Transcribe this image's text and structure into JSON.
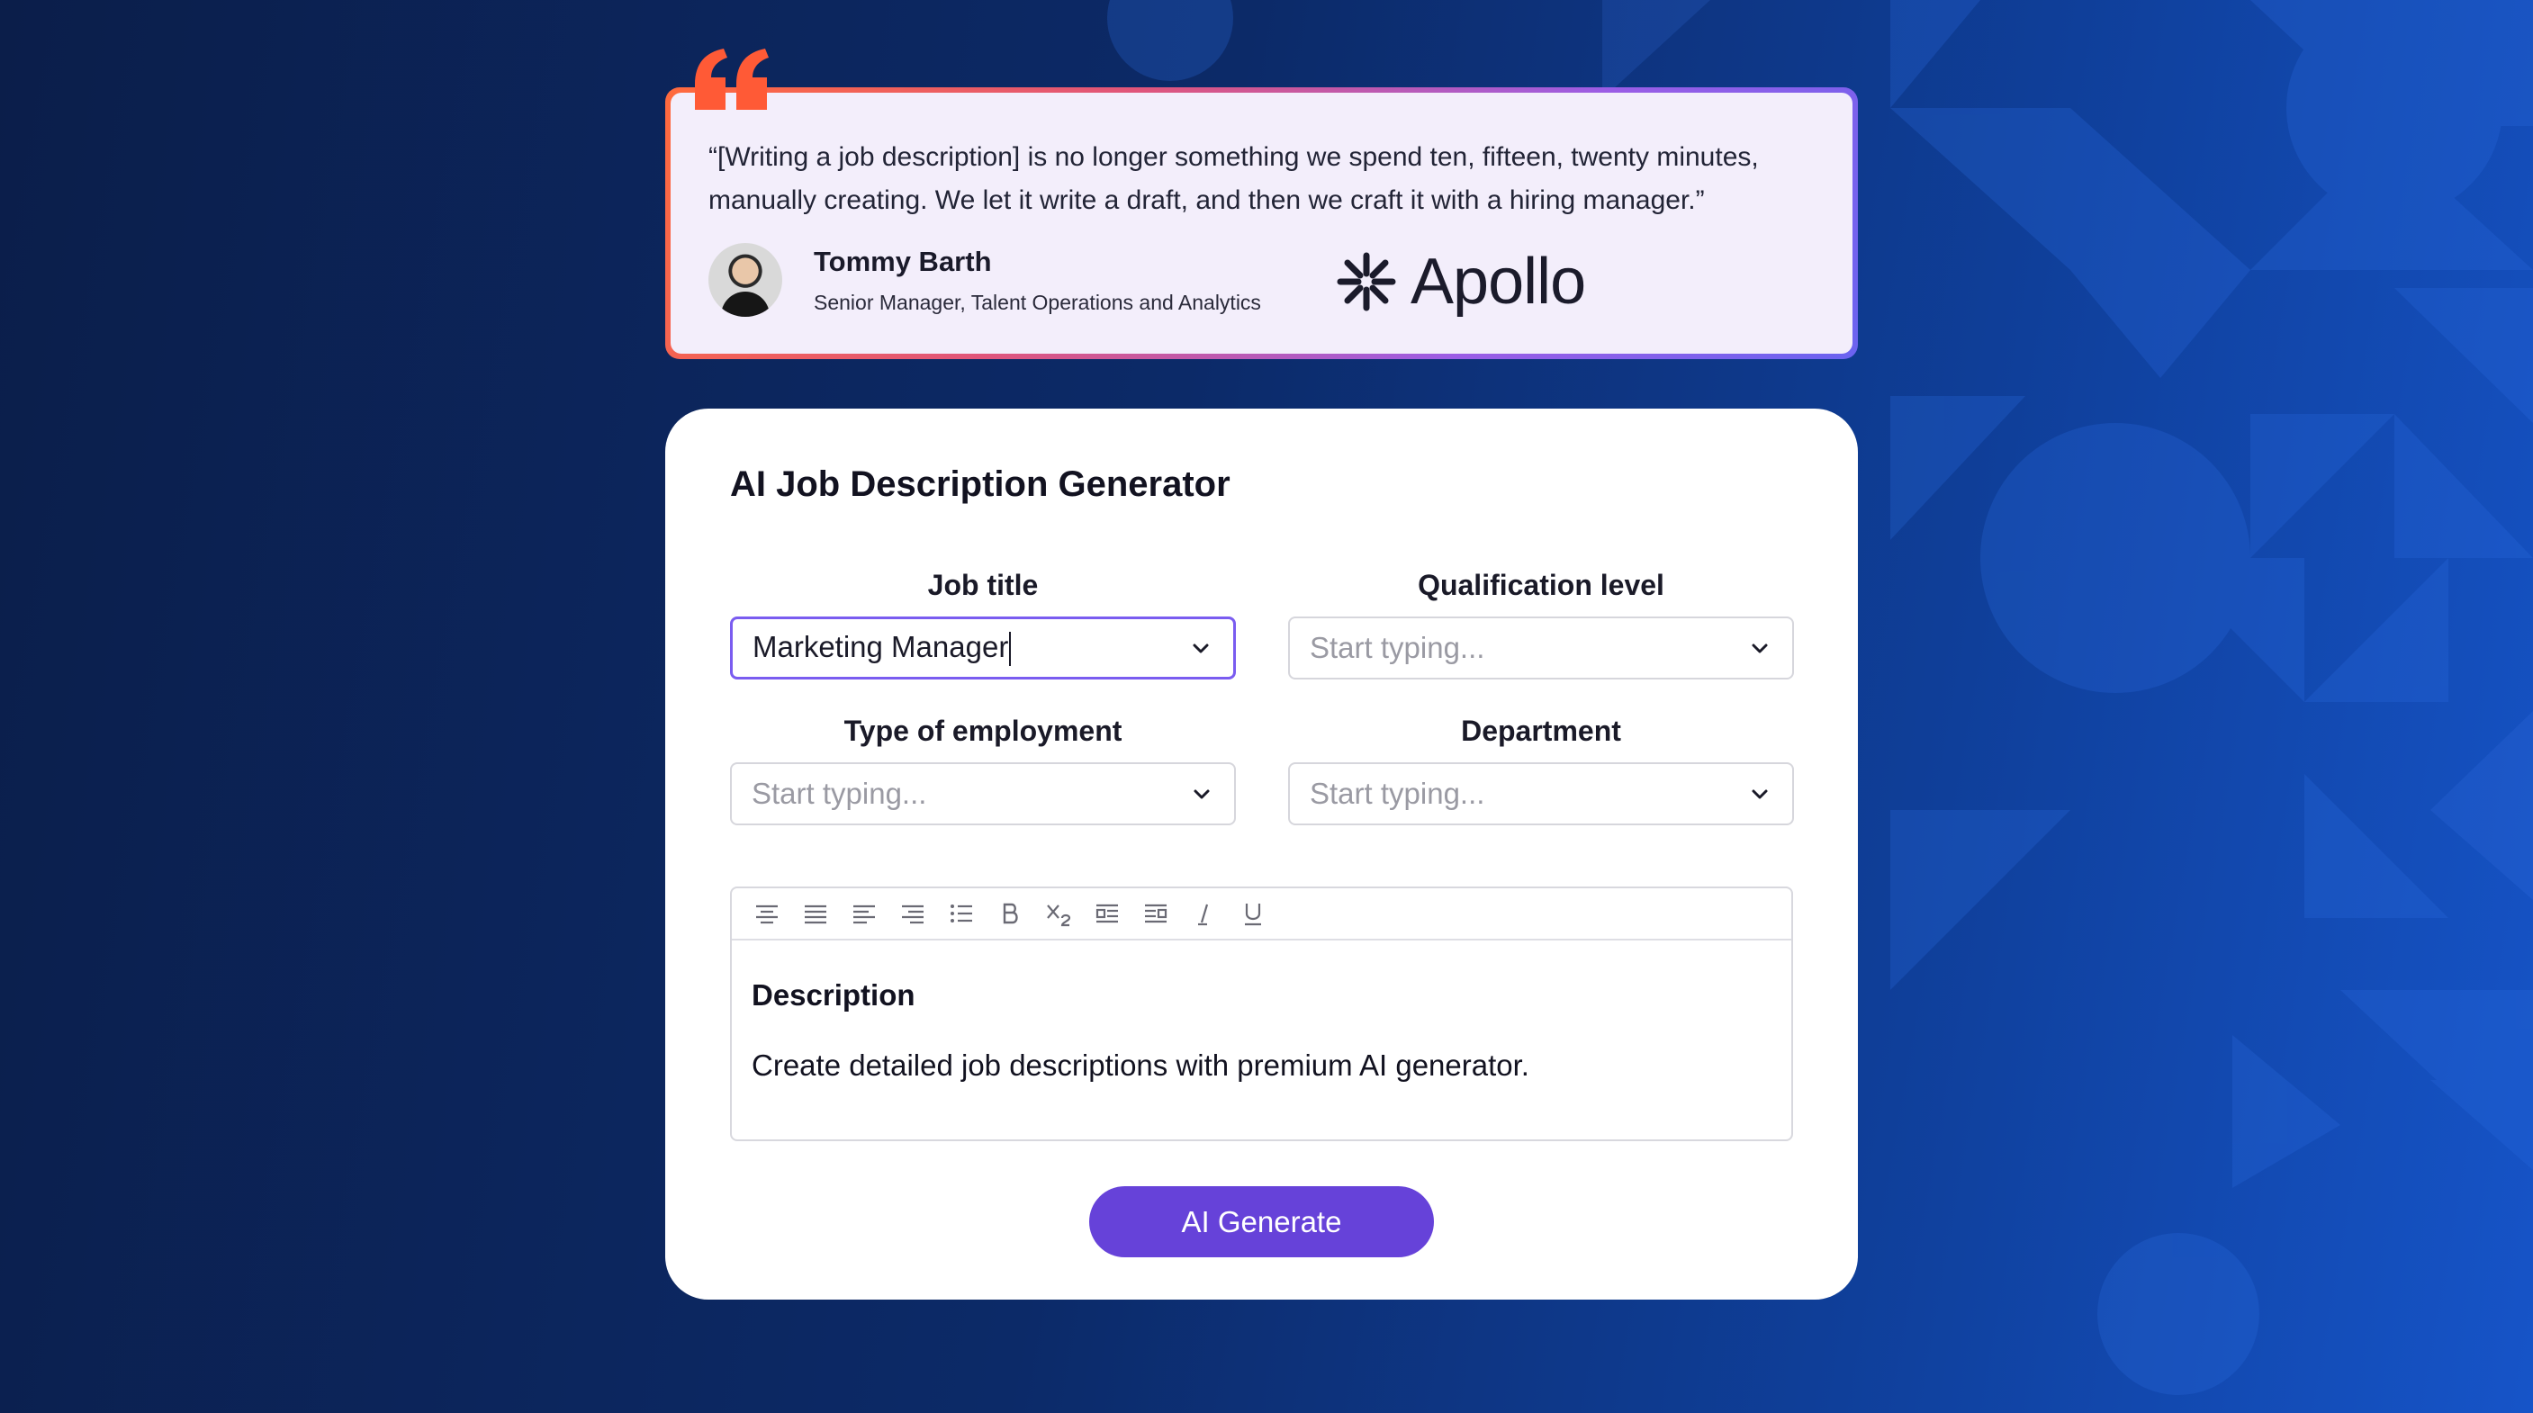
{
  "colors": {
    "background": "#0c2a68",
    "quote_mark": "#ff5a36",
    "primary": "#6642d9",
    "active_border": "#7a5cf0"
  },
  "testimonial": {
    "quote": "“[Writing a job description] is no longer something we spend ten, fifteen, twenty minutes, manually creating. We let it write a draft, and then we craft it with a hiring manager.”",
    "author_name": "Tommy Barth",
    "author_role": "Senior Manager, Talent Operations and Analytics",
    "company": "Apollo",
    "quote_icon": "quote-mark-icon",
    "logo_icon": "apollo-asterisk-logo"
  },
  "generator": {
    "title": "AI Job Description Generator",
    "fields": {
      "job_title": {
        "label": "Job title",
        "value": "Marketing Manager"
      },
      "qualification": {
        "label": "Qualification level",
        "placeholder": "Start typing..."
      },
      "employment": {
        "label": "Type of employment",
        "placeholder": "Start typing..."
      },
      "department": {
        "label": "Department",
        "placeholder": "Start typing..."
      }
    },
    "toolbar": [
      "align-center-icon",
      "align-justify-icon",
      "align-left-icon",
      "align-right-icon",
      "bullet-list-icon",
      "bold-icon",
      "subscript-icon",
      "indent-icon",
      "outdent-icon",
      "italic-icon",
      "underline-icon"
    ],
    "editor": {
      "heading": "Description",
      "body": "Create detailed job descriptions with premium AI generator."
    },
    "generate_label": "AI Generate"
  }
}
